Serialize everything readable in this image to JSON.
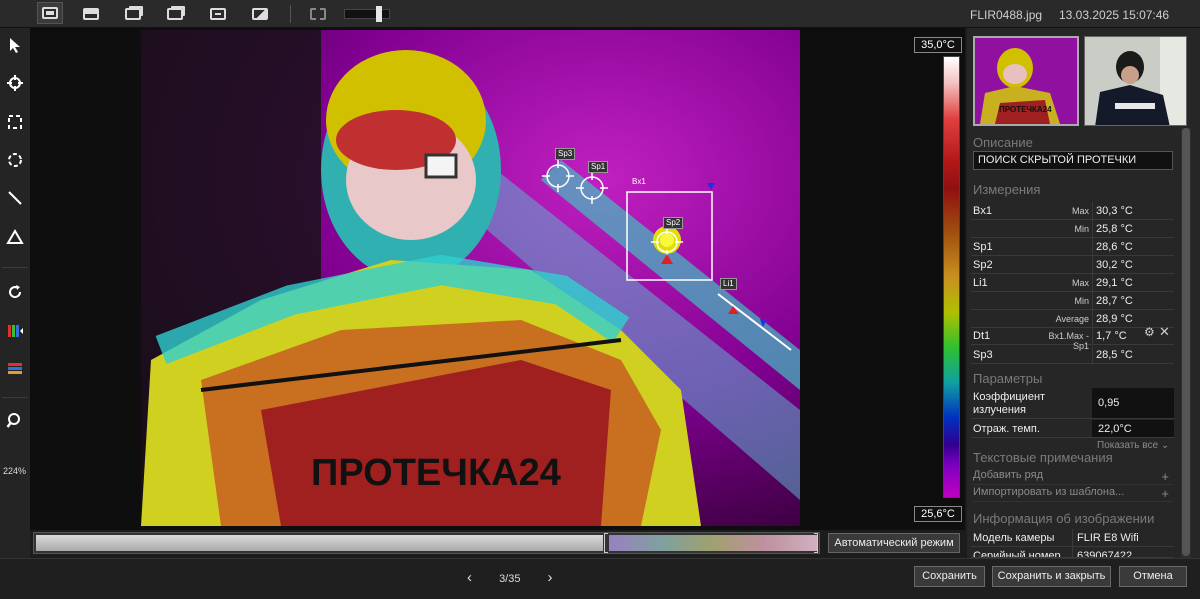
{
  "toolbar": {
    "file_name": "FLIR0488.jpg",
    "date_time": "13.03.2025 15:07:46"
  },
  "left_tools": {
    "zoom_level": "224%"
  },
  "scale": {
    "max_temp": "35,0°C",
    "min_temp": "25,6°C"
  },
  "image_overlay": {
    "brand_text": "ПРОТЕЧКА24",
    "labels": {
      "sp3": "Sp3",
      "sp1": "Sp1",
      "bx1": "Bx1",
      "sp2": "Sp2",
      "li1": "Li1"
    }
  },
  "range": {
    "auto_button": "Автоматический режим"
  },
  "pager": {
    "prev": "‹",
    "position": "3/35",
    "next": "›"
  },
  "buttons": {
    "save": "Сохранить",
    "save_close": "Сохранить и закрыть",
    "cancel": "Отмена"
  },
  "panel": {
    "thumb_brand": "ПРОТЕЧКА24",
    "description_title": "Описание",
    "description_value": "ПОИСК СКРЫТОЙ ПРОТЕЧКИ",
    "measurements_title": "Измерения",
    "measurements": [
      {
        "label": "Bx1",
        "sub": "Max",
        "value": "30,3 °C"
      },
      {
        "label": "",
        "sub": "Min",
        "value": "25,8 °C"
      },
      {
        "label": "Sp1",
        "sub": "",
        "value": "28,6 °C"
      },
      {
        "label": "Sp2",
        "sub": "",
        "value": "30,2 °C"
      },
      {
        "label": "Li1",
        "sub": "Max",
        "value": "29,1 °C"
      },
      {
        "label": "",
        "sub": "Min",
        "value": "28,7 °C"
      },
      {
        "label": "",
        "sub": "Average",
        "value": "28,9 °C"
      },
      {
        "label": "Dt1",
        "sub": "Bx1.Max - Sp1",
        "value": "1,7 °C"
      },
      {
        "label": "Sp3",
        "sub": "",
        "value": "28,5 °C"
      }
    ],
    "params_title": "Параметры",
    "emissivity_label": "Коэффициент излучения",
    "emissivity_value": "0,95",
    "refl_label": "Отраж. темп.",
    "refl_value": "22,0°C",
    "show_all": "Показать все",
    "notes_title": "Текстовые примечания",
    "add_row": "Добавить ряд",
    "import_template": "Импортировать из шаблона...",
    "info_title": "Информация об изображении",
    "camera_label": "Модель камеры",
    "camera_value": "FLIR E8 Wifi",
    "serial_label": "Серийный номер",
    "serial_value": "639067422"
  },
  "colors": {
    "background": "#1c1c1c",
    "panel": "#262626",
    "accent_scale_top": "#ffffff",
    "accent_scale_bottom": "#c000c0"
  },
  "icons": [
    "select-arrow-icon",
    "spot-icon",
    "box-icon",
    "circle-icon",
    "line-icon",
    "delta-icon",
    "rotate-icon",
    "palette-icon",
    "color-scale-icon",
    "zoom-icon"
  ]
}
